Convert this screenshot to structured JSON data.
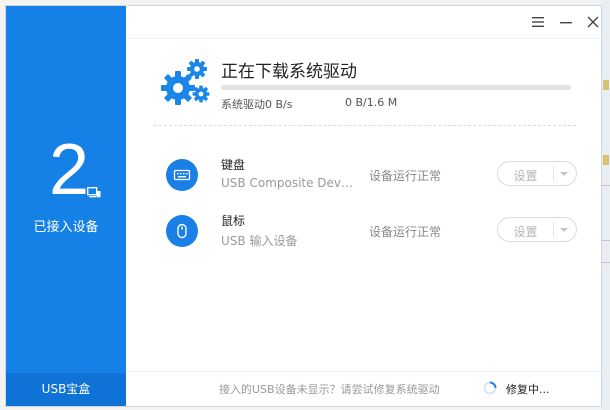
{
  "sidebar": {
    "device_count": "2",
    "connected_label": "已接入设备",
    "footer_label": "USB宝盒"
  },
  "download": {
    "title": "正在下载系统驱动",
    "speed_text": "系统驱动0 B/s",
    "size_text": "0 B/1.6 M",
    "progress": 0
  },
  "devices": [
    {
      "name": "键盘",
      "model": "USB Composite Device",
      "status": "设备运行正常",
      "button_label": "设置",
      "icon": "keyboard-icon"
    },
    {
      "name": "鼠标",
      "model": "USB 输入设备",
      "status": "设备运行正常",
      "button_label": "设置",
      "icon": "mouse-icon"
    }
  ],
  "footer": {
    "hint": "接入的USB设备未显示？请尝试修复系统驱动",
    "repair_label": "修复中..."
  },
  "colors": {
    "accent": "#1580e6",
    "sidebar_footer": "#0f72d6",
    "icon_circle": "#1a7fe6"
  }
}
